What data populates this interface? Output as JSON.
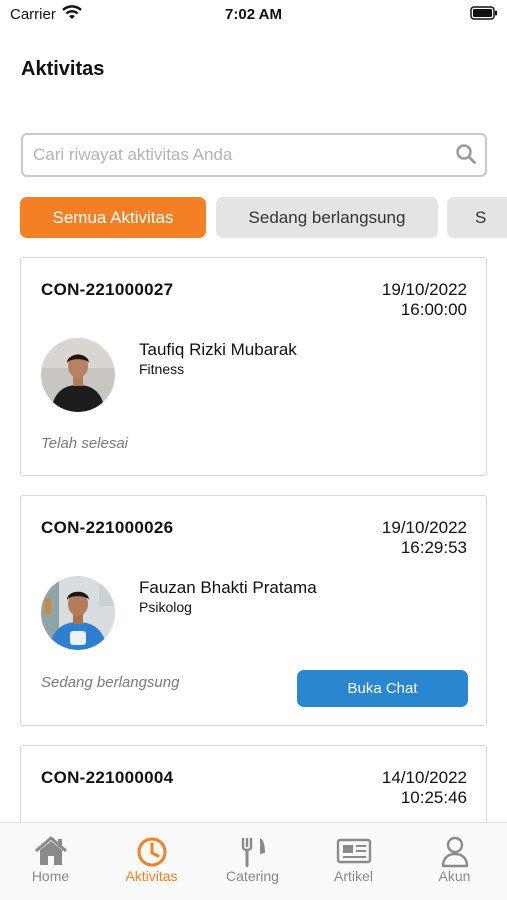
{
  "status_bar": {
    "carrier": "Carrier",
    "time": "7:02 AM"
  },
  "header": {
    "title": "Aktivitas"
  },
  "search": {
    "placeholder": "Cari riwayat aktivitas Anda",
    "value": ""
  },
  "filters": [
    {
      "label": "Semua Aktivitas",
      "active": true
    },
    {
      "label": "Sedang berlangsung",
      "active": false
    },
    {
      "label": "S",
      "active": false
    }
  ],
  "activities": [
    {
      "id": "CON-221000027",
      "date": "19/10/2022",
      "time": "16:00:00",
      "name": "Taufiq Rizki Mubarak",
      "role": "Fitness",
      "status": "Telah selesai"
    },
    {
      "id": "CON-221000026",
      "date": "19/10/2022",
      "time": "16:29:53",
      "name": "Fauzan Bhakti Pratama",
      "role": "Psikolog",
      "status": "Sedang berlangsung",
      "action_label": "Buka Chat"
    },
    {
      "id": "CON-221000004",
      "date": "14/10/2022",
      "time": "10:25:46"
    }
  ],
  "tabs": [
    {
      "label": "Home",
      "icon": "home-icon"
    },
    {
      "label": "Aktivitas",
      "icon": "clock-icon",
      "active": true
    },
    {
      "label": "Catering",
      "icon": "fork-knife-icon"
    },
    {
      "label": "Artikel",
      "icon": "newspaper-icon"
    },
    {
      "label": "Akun",
      "icon": "user-icon"
    }
  ],
  "colors": {
    "accent": "#f47f24",
    "button": "#2a86cf",
    "chip_inactive": "#e4e4e4",
    "muted_text": "#7a7a7a"
  }
}
